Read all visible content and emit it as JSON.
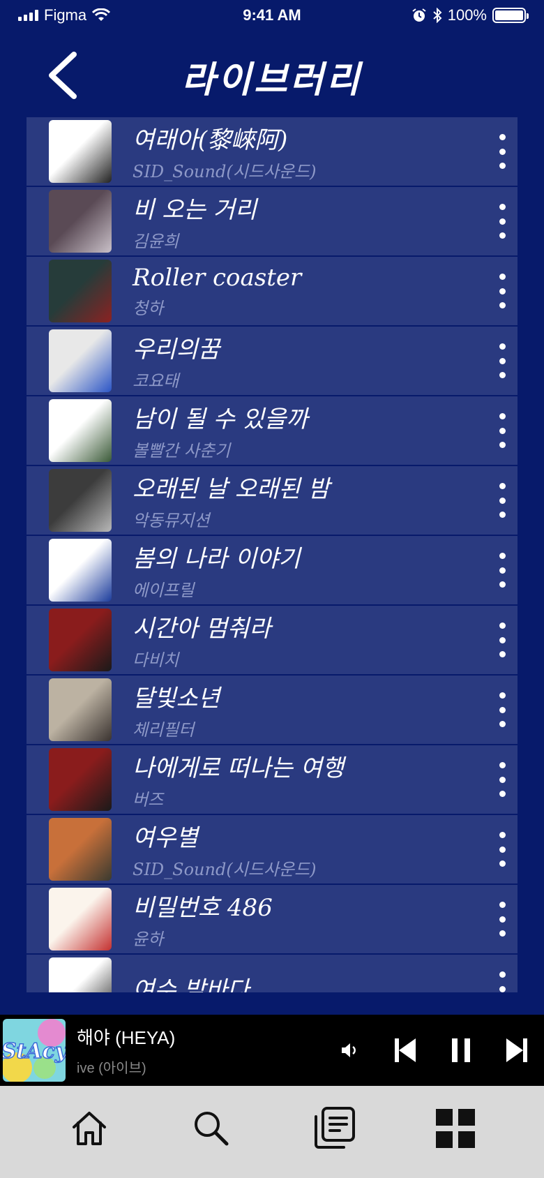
{
  "status_bar": {
    "carrier": "Figma",
    "time": "9:41 AM",
    "battery": "100%"
  },
  "header": {
    "title": "라이브러리"
  },
  "songs": [
    {
      "title": "여래아(黎崍阿)",
      "artist": "SID_Sound(시드사운드)",
      "art_colors": [
        "#ffffff",
        "#222222"
      ]
    },
    {
      "title": "비 오는 거리",
      "artist": "김윤희",
      "art_colors": [
        "#5a4a55",
        "#c9c0c8"
      ]
    },
    {
      "title": "Roller coaster",
      "artist": "청하",
      "art_colors": [
        "#263c3a",
        "#8b2222"
      ]
    },
    {
      "title": "우리의꿈",
      "artist": "코요태",
      "art_colors": [
        "#e8e8e8",
        "#2b55c6"
      ]
    },
    {
      "title": "남이 될 수 있을까",
      "artist": "볼빨간 사춘기",
      "art_colors": [
        "#ffffff",
        "#3a5a38"
      ]
    },
    {
      "title": "오래된 날 오래된 밤",
      "artist": "악동뮤지션",
      "art_colors": [
        "#3c3c3c",
        "#b8b8b8"
      ]
    },
    {
      "title": "봄의 나라 이야기",
      "artist": "에이프릴",
      "art_colors": [
        "#ffffff",
        "#1c3c9c"
      ]
    },
    {
      "title": "시간아 멈춰라",
      "artist": "다비치",
      "art_colors": [
        "#8a1c1c",
        "#1a1a1a"
      ]
    },
    {
      "title": "달빛소년",
      "artist": "체리필터",
      "art_colors": [
        "#bcb2a2",
        "#3a3330"
      ]
    },
    {
      "title": "나에게로 떠나는 여행",
      "artist": "버즈",
      "art_colors": [
        "#8a1c1c",
        "#1a1a1a"
      ]
    },
    {
      "title": "여우별",
      "artist": "SID_Sound(시드사운드)",
      "art_colors": [
        "#c8703a",
        "#3a3a30"
      ]
    },
    {
      "title": "비밀번호 486",
      "artist": "윤하",
      "art_colors": [
        "#fbf4ec",
        "#c43030"
      ]
    },
    {
      "title": "여수 밤바다",
      "artist": "",
      "art_colors": [
        "#ffffff",
        "#222222"
      ]
    }
  ],
  "now_playing": {
    "title": "해야 (HEYA)",
    "artist": "ive (아이브)"
  },
  "tab_bar": {
    "tabs": [
      "home",
      "search",
      "library",
      "grid"
    ]
  }
}
